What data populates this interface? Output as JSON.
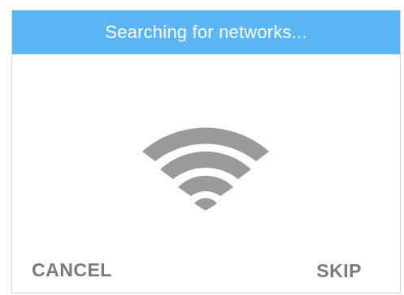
{
  "dialog": {
    "title": "Searching for networks...",
    "icon": "wifi-signal-icon",
    "cancel_label": "CANCEL",
    "skip_label": "SKIP"
  },
  "colors": {
    "header_bg": "#5ab6f5",
    "header_text": "#ffffff",
    "icon": "#9a9a9a",
    "button_text": "#7a7a7a",
    "border": "#d2d2d2"
  }
}
